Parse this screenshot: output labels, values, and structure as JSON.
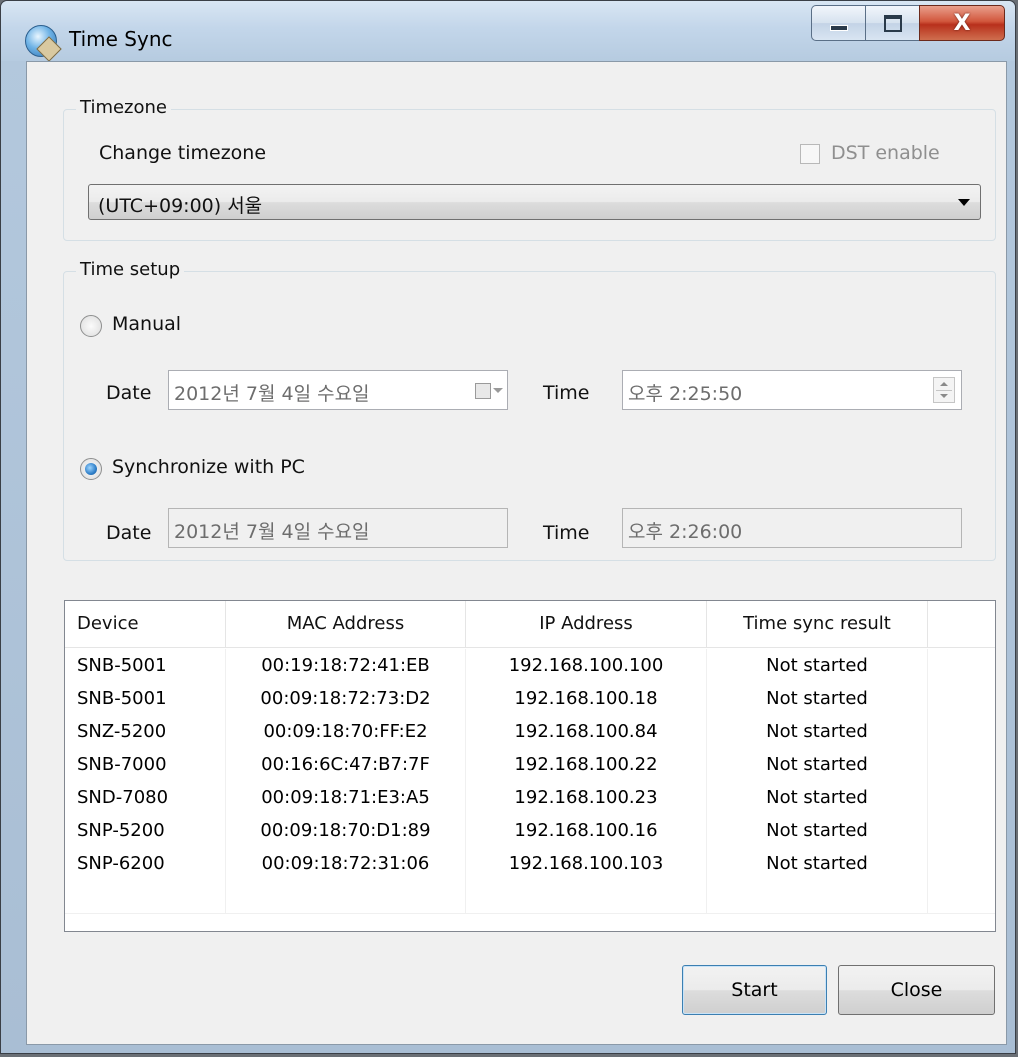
{
  "window": {
    "title": "Time Sync"
  },
  "timezone": {
    "legend": "Timezone",
    "change_label": "Change timezone",
    "dst_label": "DST enable",
    "selected": "(UTC+09:00) 서울"
  },
  "time_setup": {
    "legend": "Time setup",
    "manual_label": "Manual",
    "manual_date_label": "Date",
    "manual_date_value": "2012년  7월  4일 수요일",
    "manual_time_label": "Time",
    "manual_time_value": "오후  2:25:50",
    "sync_label": "Synchronize with PC",
    "sync_date_label": "Date",
    "sync_date_value": "2012년 7월 4일 수요일",
    "sync_time_label": "Time",
    "sync_time_value": "오후 2:26:00"
  },
  "device_list": {
    "columns": [
      "Device",
      "MAC Address",
      "IP Address",
      "Time sync result"
    ],
    "rows": [
      [
        "SNB-5001",
        "00:19:18:72:41:EB",
        "192.168.100.100",
        "Not started"
      ],
      [
        "SNB-5001",
        "00:09:18:72:73:D2",
        "192.168.100.18",
        "Not started"
      ],
      [
        "SNZ-5200",
        "00:09:18:70:FF:E2",
        "192.168.100.84",
        "Not started"
      ],
      [
        "SNB-7000",
        "00:16:6C:47:B7:7F",
        "192.168.100.22",
        "Not started"
      ],
      [
        "SND-7080",
        "00:09:18:71:E3:A5",
        "192.168.100.23",
        "Not started"
      ],
      [
        "SNP-5200",
        "00:09:18:70:D1:89",
        "192.168.100.16",
        "Not started"
      ],
      [
        "SNP-6200",
        "00:09:18:72:31:06",
        "192.168.100.103",
        "Not started"
      ]
    ]
  },
  "buttons": {
    "start": "Start",
    "close": "Close"
  },
  "icons": {
    "app": "time-sync-app-icon",
    "minimize": "minimize-icon",
    "maximize": "maximize-icon",
    "close": "close-icon",
    "calendar": "calendar-icon",
    "spinner": "spinner-icon",
    "dropdown": "chevron-down-icon"
  },
  "colors": {
    "window_bg": "#f0f0f0",
    "close_button": "#c8432b",
    "radio_selected": "#2f7fc9"
  }
}
